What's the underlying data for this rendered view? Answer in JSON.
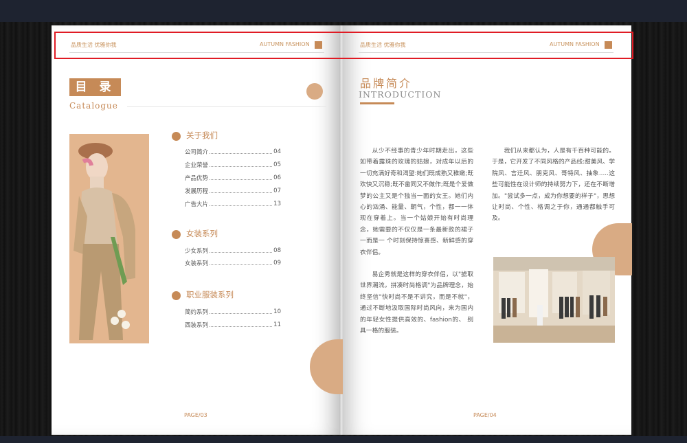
{
  "header": {
    "left_tagline": "品质生活 优雅你我",
    "right_tagline": "AUTUMN FASHION"
  },
  "left_page": {
    "toc_title": "目 录",
    "toc_subtitle": "Catalogue",
    "sections": [
      {
        "title": "关于我们",
        "items": [
          {
            "label": "公司简介",
            "page": "04"
          },
          {
            "label": "企业荣誉",
            "page": "05"
          },
          {
            "label": "产品优势",
            "page": "06"
          },
          {
            "label": "发展历程",
            "page": "07"
          },
          {
            "label": "广告大片",
            "page": "13"
          }
        ]
      },
      {
        "title": "女装系列",
        "items": [
          {
            "label": "少女系列",
            "page": "08"
          },
          {
            "label": "女装系列",
            "page": "09"
          }
        ]
      },
      {
        "title": "职业服装系列",
        "items": [
          {
            "label": "简约系列",
            "page": "10"
          },
          {
            "label": "西装系列",
            "page": "11"
          }
        ]
      }
    ],
    "page_number": "PAGE/03"
  },
  "right_page": {
    "title_cn": "品牌简介",
    "title_en": "INTRODUCTION",
    "paragraph_1": "从少不经事的青少年时期走出，这些如带着露珠的玫瑰的姑娘，对成年以后的一切充满好奇和渴望:她们既成熟又稚嫩;既欢快又沉稳;既不畲同又不做作;既是个爱做梦的公主又是个独当一面的女王。她们内心的汹涌、能量、朝气，个性，都一一体现在穿着上。当一个姑娘开始有时尚理念，她需要的不仅仅是一条最新款的裙子一而是一 个时刻保持惊喜感、新鲜感的穿衣伴侣。",
    "paragraph_2": "易企秀就是这样的穿衣伴侣，以\"掳取世界潮流，拼凑时尚格调\"为品牌理念，始终坚信\"快时尚不是不讲究，而是不就\"，通过不断地汲取国际时尚风向，来为国内的年轻女性提供高效的、fashion的、 别具一格的服装。",
    "paragraph_3": "我们从来都认为，人是有千百种可能的。于是，它开发了不同风格的产品线:甜美风、学院风、言迁风、朋克风、哥特风、抽象.....这些可能性在设计师的持续努力下，还在不断增加。\"尝试多一点，成为你想要的样子\"，思想让时尚、个性、格调之于你，通通都触手可及。",
    "page_number": "PAGE/04"
  }
}
